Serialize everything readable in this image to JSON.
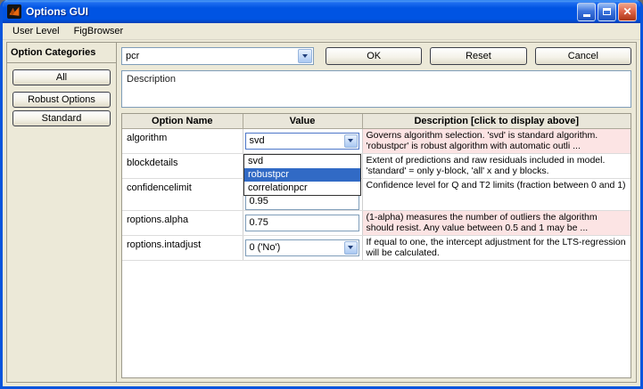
{
  "window": {
    "title": "Options GUI"
  },
  "menu": {
    "items": [
      {
        "label": "User Level"
      },
      {
        "label": "FigBrowser"
      }
    ]
  },
  "left_panel": {
    "title": "Option Categories",
    "buttons": [
      "All",
      "Robust Options",
      "Standard"
    ]
  },
  "toolbar": {
    "method_value": "pcr",
    "ok_label": "OK",
    "reset_label": "Reset",
    "cancel_label": "Cancel"
  },
  "description_panel": {
    "label": "Description"
  },
  "table": {
    "headers": [
      "Option Name",
      "Value",
      "Description [click to display above]"
    ],
    "rows": [
      {
        "name": "algorithm",
        "value": "svd",
        "description": "Governs algorithm selection. 'svd' is standard algorithm. 'robustpcr' is robust algorithm with automatic outli ...",
        "highlighted": true
      },
      {
        "name": "blockdetails",
        "value": "",
        "description": "Extent of predictions and raw residuals included in model. 'standard' = only y-block, 'all' x and y blocks.",
        "highlighted": false
      },
      {
        "name": "confidencelimit",
        "value": "0.95",
        "description": "Confidence level for Q and T2 limits (fraction between 0 and 1)",
        "highlighted": false
      },
      {
        "name": "roptions.alpha",
        "value": "0.75",
        "description": "(1-alpha) measures the number of outliers the algorithm should resist. Any value between 0.5 and 1 may be ...",
        "highlighted": true
      },
      {
        "name": "roptions.intadjust",
        "value": "0 ('No')",
        "description": "If equal to one, the intercept adjustment for the LTS-regression will be calculated.",
        "highlighted": false
      }
    ]
  },
  "dropdown": {
    "items": [
      "svd",
      "robustpcr",
      "correlationpcr"
    ],
    "selected": "robustpcr"
  },
  "icons": {
    "app": "matlab-logo",
    "close_glyph": "✕"
  },
  "colors": {
    "highlight_row": "#fce4e4",
    "selection_blue": "#316ac5",
    "titlebar_blue": "#0054e3",
    "window_bg": "#ece9d8"
  }
}
